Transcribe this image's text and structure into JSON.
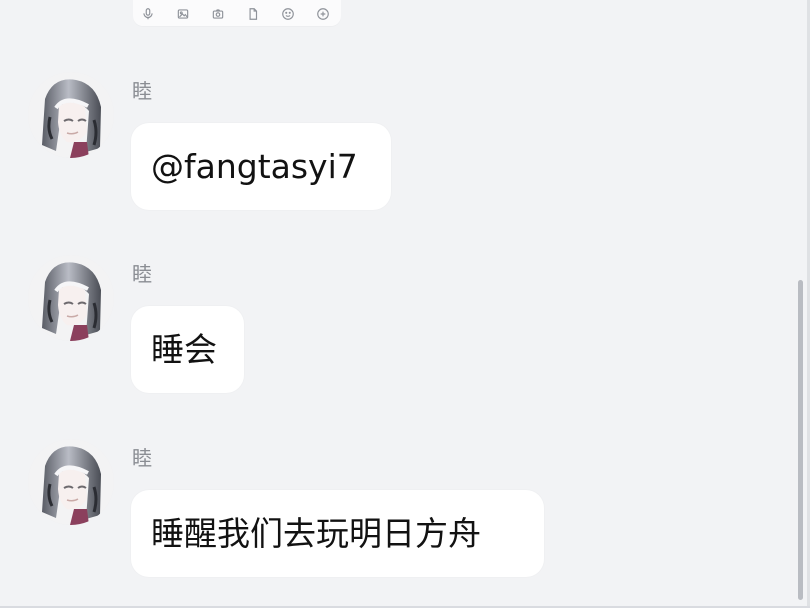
{
  "toolbar": {
    "icons": [
      {
        "name": "microphone-icon",
        "color": "#8f939a"
      },
      {
        "name": "image-icon",
        "color": "#8f939a"
      },
      {
        "name": "camera-icon",
        "color": "#8f939a"
      },
      {
        "name": "file-icon",
        "color": "#8f939a"
      },
      {
        "name": "emoji-icon",
        "color": "#8f939a"
      },
      {
        "name": "add-circle-icon",
        "color": "#8f939a"
      }
    ]
  },
  "messages": [
    {
      "sender": "睦",
      "text": "@fangtasyi7"
    },
    {
      "sender": "睦",
      "text": "睡会"
    },
    {
      "sender": "睦",
      "text": "睡醒我们去玩明日方舟"
    }
  ],
  "colors": {
    "background": "#f2f3f5",
    "bubble": "#ffffff",
    "sender": "#8a8d93",
    "message_text": "#121212",
    "scrollbar": "#b9bcc2"
  }
}
